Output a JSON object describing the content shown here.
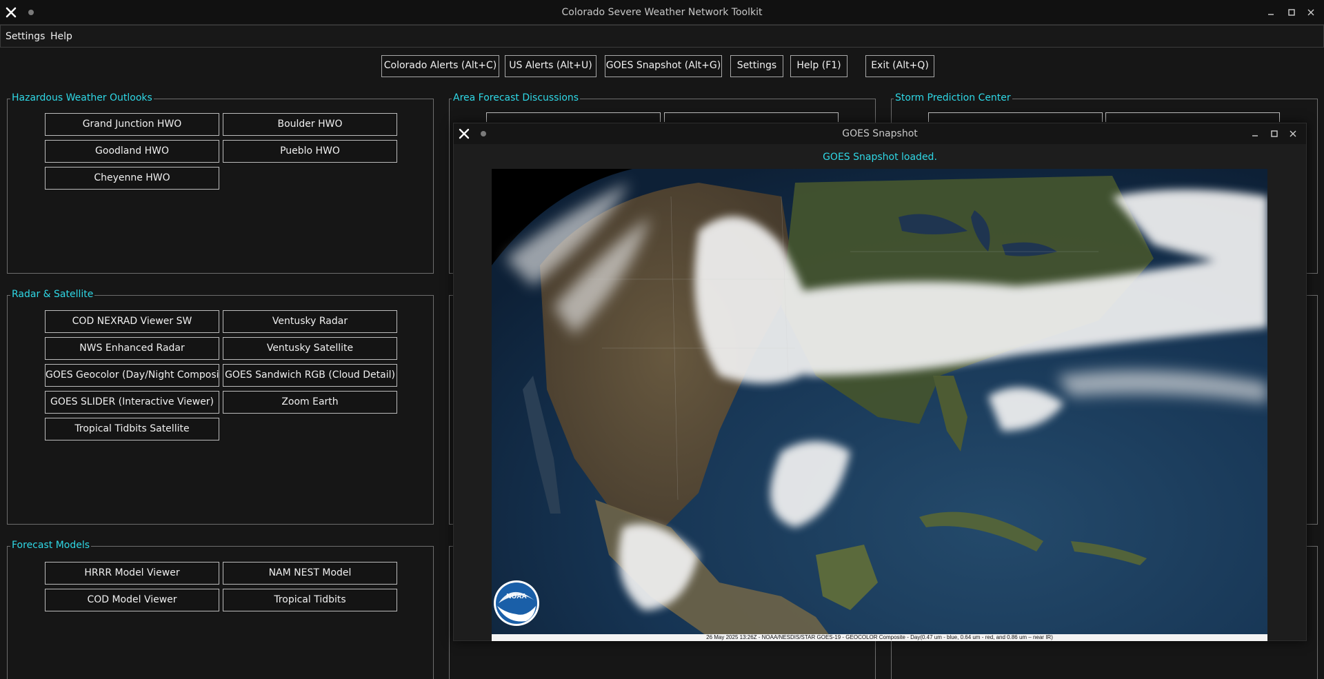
{
  "window": {
    "title": "Colorado Severe Weather Network Toolkit",
    "close_icon": "close-x-icon",
    "controls": [
      "minimize-icon",
      "maximize-icon",
      "close-icon"
    ]
  },
  "menu": {
    "items": [
      "Settings",
      "Help"
    ]
  },
  "toolbar": {
    "buttons": [
      "Colorado Alerts (Alt+C)",
      "US Alerts (Alt+U)",
      "GOES Snapshot (Alt+G)",
      "Settings",
      "Help (F1)",
      "Exit (Alt+Q)"
    ]
  },
  "groups": {
    "hwo": {
      "title": "Hazardous Weather Outlooks",
      "buttons": [
        "Grand Junction HWO",
        "Boulder HWO",
        "Goodland HWO",
        "Pueblo HWO",
        "Cheyenne HWO"
      ]
    },
    "afd": {
      "title": "Area Forecast Discussions"
    },
    "spc": {
      "title": "Storm Prediction Center"
    },
    "radar": {
      "title": "Radar & Satellite",
      "buttons": [
        "COD NEXRAD Viewer SW",
        "Ventusky Radar",
        "NWS Enhanced Radar",
        "Ventusky Satellite",
        "GOES Geocolor (Day/Night Composite)",
        "GOES Sandwich RGB (Cloud Detail)",
        "GOES SLIDER (Interactive Viewer)",
        "Zoom Earth",
        "Tropical Tidbits Satellite"
      ]
    },
    "models": {
      "title": "Forecast Models",
      "buttons": [
        "HRRR Model Viewer",
        "NAM NEST Model",
        "COD Model Viewer",
        "Tropical Tidbits"
      ]
    }
  },
  "goes_window": {
    "title": "GOES Snapshot",
    "status": "GOES Snapshot loaded.",
    "logo_text": "NOAA",
    "caption": "26 May 2025 13:26Z - NOAA/NESDIS/STAR GOES-19 - GEOCOLOR Composite - Day(0.47 um - blue, 0.64 um - red, and 0.86 um – near IR)"
  },
  "colors": {
    "accent": "#2fd8e6",
    "background": "#161616",
    "button_border": "#bdbdbd"
  }
}
